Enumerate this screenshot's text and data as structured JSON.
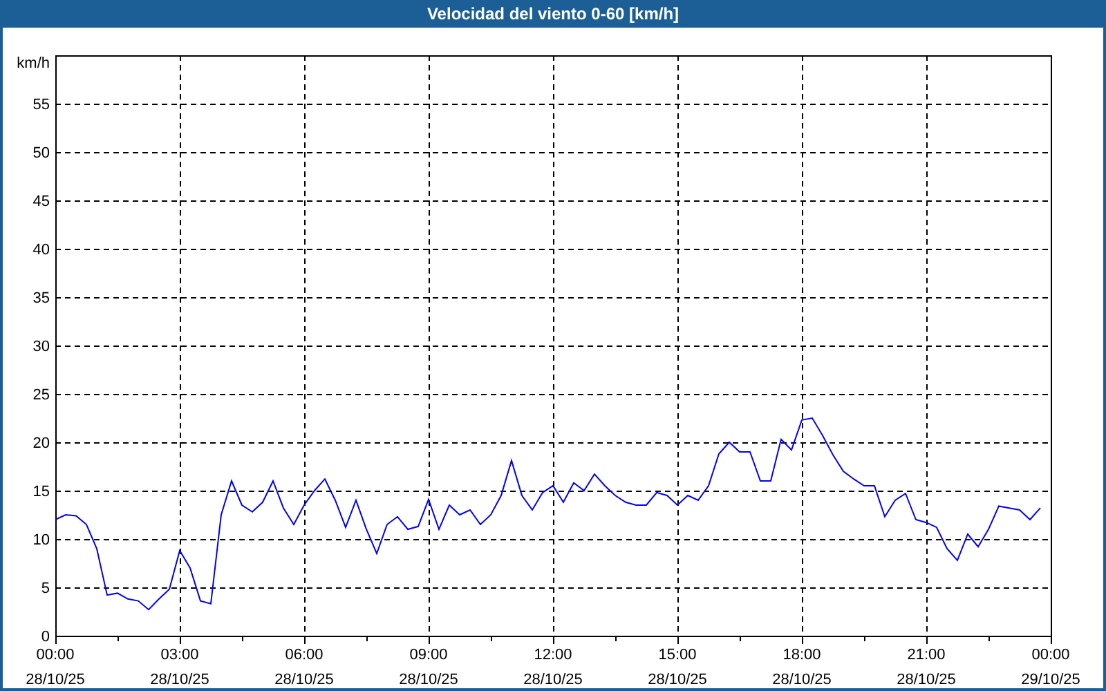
{
  "chart_data": {
    "type": "line",
    "title": "Velocidad del viento 0-60 [km/h]",
    "ylabel": "km/h",
    "ylim": [
      0,
      60
    ],
    "grid": true,
    "yticks": [
      0,
      5,
      10,
      15,
      20,
      25,
      30,
      35,
      40,
      45,
      50,
      55
    ],
    "categories": [
      "00:00 28/10/25",
      null,
      null,
      null,
      null,
      null,
      null,
      null,
      null,
      null,
      null,
      null,
      "03:00 28/10/25",
      null,
      null,
      null,
      null,
      null,
      null,
      null,
      null,
      null,
      null,
      null,
      "06:00 28/10/25",
      null,
      null,
      null,
      null,
      null,
      null,
      null,
      null,
      null,
      null,
      null,
      "09:00 28/10/25",
      null,
      null,
      null,
      null,
      null,
      null,
      null,
      null,
      null,
      null,
      null,
      "12:00 28/10/25",
      null,
      null,
      null,
      null,
      null,
      null,
      null,
      null,
      null,
      null,
      null,
      "15:00 28/10/25",
      null,
      null,
      null,
      null,
      null,
      null,
      null,
      null,
      null,
      null,
      null,
      "18:00 28/10/25",
      null,
      null,
      null,
      null,
      null,
      null,
      null,
      null,
      null,
      null,
      null,
      "21:00 28/10/25",
      null,
      null,
      null,
      null,
      null,
      null,
      null,
      null,
      null,
      null,
      null,
      "00:00 29/10/25"
    ],
    "series": [
      {
        "color": "#0000ff",
        "values": [
          12,
          12.5,
          12.4,
          11.5,
          9,
          4.2,
          4.4,
          3.8,
          3.6,
          2.7,
          3.8,
          4.8,
          8.8,
          7,
          3.6,
          3.3,
          12.5,
          16,
          13.5,
          12.8,
          13.8,
          16,
          13.2,
          11.5,
          13.5,
          15,
          16.2,
          14,
          11.2,
          14,
          11,
          8.5,
          11.5,
          12.3,
          11,
          11.3,
          14.1,
          11,
          13.5,
          12.5,
          13,
          11.5,
          12.5,
          14.5,
          18.1,
          14.5,
          13,
          14.8,
          15.5,
          13.8,
          15.8,
          15,
          16.7,
          15.5,
          14.5,
          13.8,
          13.5,
          13.5,
          14.8,
          14.5,
          13.5,
          14.5,
          14,
          15.5,
          18.8,
          20,
          19,
          19,
          16,
          16,
          20.3,
          19.2,
          22.3,
          22.5,
          20.7,
          18.7,
          17,
          16.2,
          15.5,
          15.5,
          12.3,
          14,
          14.7,
          12,
          11.7,
          11.2,
          9,
          7.8,
          10.5,
          9.2,
          11,
          13.4,
          13.2,
          13,
          12,
          13.2,
          null
        ]
      }
    ]
  }
}
